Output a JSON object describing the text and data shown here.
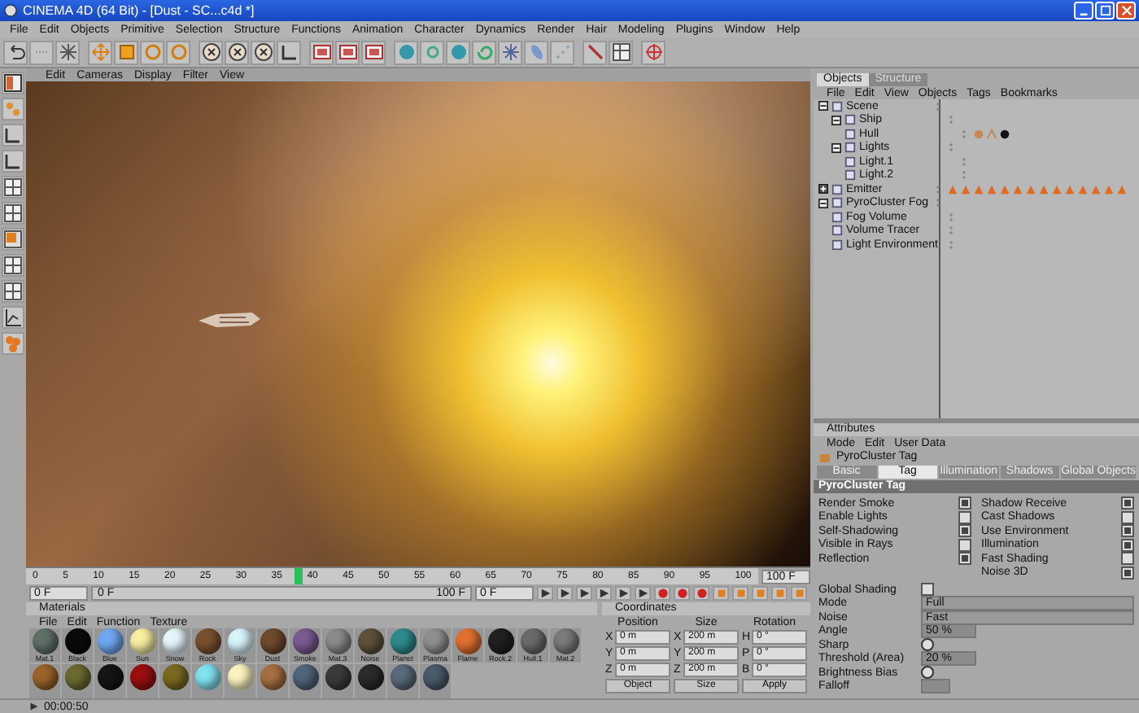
{
  "window": {
    "title": "CINEMA 4D (64 Bit) - [Dust - SC...c4d *]"
  },
  "menu": [
    "File",
    "Edit",
    "Objects",
    "Primitive",
    "Selection",
    "Structure",
    "Functions",
    "Animation",
    "Character",
    "Dynamics",
    "Render",
    "Hair",
    "Modeling",
    "Plugins",
    "Window",
    "Help"
  ],
  "viewport": {
    "menu": [
      "Edit",
      "Cameras",
      "Display",
      "Filter",
      "View"
    ]
  },
  "timeline": {
    "ticks": [
      "0",
      "5",
      "10",
      "15",
      "20",
      "25",
      "30",
      "35",
      "40",
      "45",
      "50",
      "55",
      "60",
      "65",
      "70",
      "75",
      "80",
      "85",
      "90",
      "95",
      "100"
    ],
    "level": 0.37,
    "end": "100 F"
  },
  "transport": {
    "start": "0 F",
    "range_start": "0 F",
    "range_end": "100 F",
    "current": "0 F"
  },
  "materials": {
    "title": "Materials",
    "menu": [
      "File",
      "Edit",
      "Function",
      "Texture"
    ],
    "items": [
      {
        "name": "Mat.1",
        "color": "#5f6f68"
      },
      {
        "name": "Black",
        "color": "#0a0a0a"
      },
      {
        "name": "Blue",
        "color": "#6fa8f0"
      },
      {
        "name": "Sun",
        "color": "#f7eea0"
      },
      {
        "name": "Snow",
        "color": "#e6f4fb"
      },
      {
        "name": "Rock",
        "color": "#7a5130"
      },
      {
        "name": "Sky",
        "color": "#d8f4fb"
      },
      {
        "name": "Dust",
        "color": "#6e4a2c"
      },
      {
        "name": "Smoke",
        "color": "#7a5a90"
      },
      {
        "name": "Mat.3",
        "color": "#8a8a8a"
      },
      {
        "name": "Noise",
        "color": "#5e513a"
      },
      {
        "name": "Planet",
        "color": "#2e8a8c"
      },
      {
        "name": "Plasma",
        "color": "#8f8f8f"
      },
      {
        "name": "Flame",
        "color": "#e07030"
      },
      {
        "name": "Rock.2",
        "color": "#202020"
      },
      {
        "name": "Hull.1",
        "color": "#6a6a6a"
      },
      {
        "name": "Mat.2",
        "color": "#7a7a7a"
      },
      {
        "color": "#9a6428"
      },
      {
        "color": "#6a6a30"
      },
      {
        "color": "#151515"
      },
      {
        "color": "#9a0f10"
      },
      {
        "color": "#7a6a20"
      },
      {
        "color": "#80e2f0"
      },
      {
        "color": "#fbf2c0"
      },
      {
        "color": "#a57040"
      },
      {
        "color": "#50647a"
      },
      {
        "color": "#3a3a3a"
      },
      {
        "color": "#2a2a2a"
      },
      {
        "color": "#5a6a7a"
      },
      {
        "color": "#4a5a6a"
      }
    ]
  },
  "coordinates": {
    "title": "Coordinates",
    "headers": [
      "Position",
      "Size",
      "Rotation"
    ],
    "rows": [
      {
        "axis": "X",
        "position": "0 m",
        "size_axis": "X",
        "size": "200 m",
        "rot_axis": "H",
        "rotation": "0 °"
      },
      {
        "axis": "Y",
        "position": "0 m",
        "size_axis": "Y",
        "size": "200 m",
        "rot_axis": "P",
        "rotation": "0 °"
      },
      {
        "axis": "Z",
        "position": "0 m",
        "size_axis": "Z",
        "size": "200 m",
        "rot_axis": "B",
        "rotation": "0 °"
      }
    ],
    "mode": "Object",
    "size_mode": "Size",
    "apply": "Apply"
  },
  "objects_panel": {
    "tabs": [
      {
        "label": "Objects",
        "selected": true
      },
      {
        "label": "Structure",
        "selected": false
      }
    ],
    "menu": [
      "File",
      "Edit",
      "View",
      "Objects",
      "Tags",
      "Bookmarks"
    ],
    "tree": [
      {
        "name": "Scene",
        "expanded": true,
        "children": [
          {
            "name": "Ship",
            "expanded": true,
            "children": [
              {
                "name": "Hull",
                "tags": [
                  {
                    "kind": "material"
                  },
                  {
                    "kind": "phong"
                  },
                  {
                    "kind": "sphere"
                  }
                ]
              }
            ]
          },
          {
            "name": "Lights",
            "expanded": true,
            "children": [
              {
                "name": "Light.1"
              },
              {
                "name": "Light.2"
              }
            ]
          }
        ]
      },
      {
        "name": "Emitter",
        "expanded": false,
        "tags": [
          {
            "kind": "cone"
          },
          {
            "kind": "cone"
          },
          {
            "kind": "cone"
          },
          {
            "kind": "cone"
          },
          {
            "kind": "cone"
          },
          {
            "kind": "cone"
          },
          {
            "kind": "cone"
          },
          {
            "kind": "cone"
          },
          {
            "kind": "cone"
          },
          {
            "kind": "cone"
          },
          {
            "kind": "cone"
          },
          {
            "kind": "cone"
          },
          {
            "kind": "cone"
          },
          {
            "kind": "cone"
          }
        ]
      },
      {
        "name": "PyroCluster Fog",
        "expanded": true,
        "children": [
          {
            "name": "Fog Volume"
          },
          {
            "name": "Volume Tracer"
          },
          {
            "name": "Light Environment"
          }
        ]
      }
    ]
  },
  "attributes": {
    "title": "Attributes",
    "menu": [
      "Mode",
      "Edit",
      "User Data"
    ],
    "object": "PyroCluster Tag",
    "tabs": [
      {
        "label": "Basic",
        "selected": false
      },
      {
        "label": "Tag",
        "selected": true
      },
      {
        "label": "Illumination",
        "selected": false
      },
      {
        "label": "Shadows",
        "selected": false
      },
      {
        "label": "Global Objects",
        "selected": false
      }
    ],
    "section": "PyroCluster Tag",
    "left": [
      {
        "label": "Render Smoke",
        "checked": true
      },
      {
        "label": "Enable Lights",
        "checked": false
      },
      {
        "label": "Self-Shadowing",
        "checked": true
      },
      {
        "label": "Visible in Rays",
        "checked": false
      },
      {
        "label": "Reflection",
        "checked": true
      }
    ],
    "right": [
      {
        "label": "Shadow Receive",
        "checked": true
      },
      {
        "label": "Cast Shadows",
        "checked": false
      },
      {
        "label": "Use Environment",
        "checked": true
      },
      {
        "label": "Illumination",
        "checked": true
      },
      {
        "label": "Fast Shading",
        "checked": false
      },
      {
        "label": "Noise 3D",
        "checked": true
      }
    ],
    "global_shading": {
      "label": "Global Shading",
      "checked": false
    },
    "mode": {
      "label": "Mode",
      "value": "Full"
    },
    "noise": {
      "label": "Noise",
      "value": "Fast"
    },
    "angle": {
      "label": "Angle",
      "value": "50 %"
    },
    "sharp": {
      "label": "Sharp",
      "selected": false
    },
    "threshold": {
      "label": "Threshold (Area)",
      "value": "20 %"
    },
    "bias": {
      "label": "Brightness Bias",
      "selected": false
    },
    "falloff": {
      "label": "Falloff"
    }
  },
  "status": "00:00:50"
}
